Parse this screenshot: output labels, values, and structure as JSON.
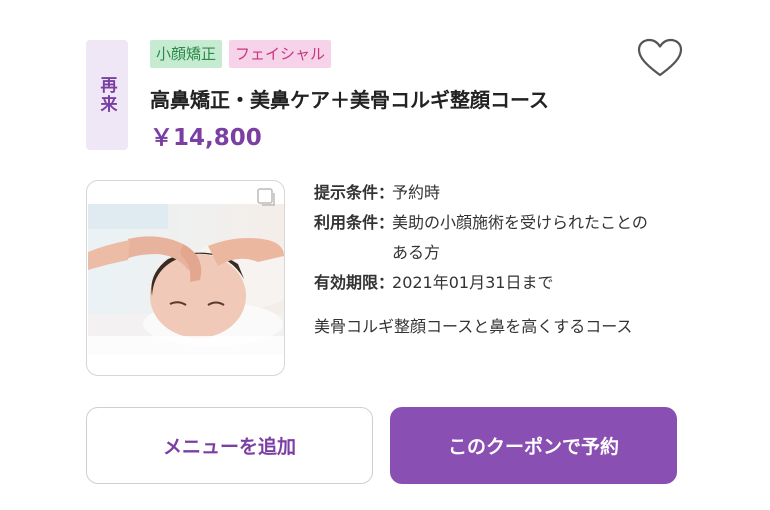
{
  "badge": {
    "label": "再来"
  },
  "tags": [
    {
      "label": "小顔矯正",
      "color": "#2a8a4a",
      "bg": "#c7ebd1"
    },
    {
      "label": "フェイシャル",
      "color": "#c4367f",
      "bg": "#f7d3ea"
    }
  ],
  "coupon": {
    "title": "高鼻矯正・美鼻ケア＋美骨コルギ整顔コース",
    "price": "￥14,800",
    "conditions": [
      {
        "label": "提示条件",
        "value": "予約時"
      },
      {
        "label": "利用条件",
        "value": "美助の小顔施術を受けられたことのある方"
      },
      {
        "label": "有効期限",
        "value": "2021年01月31日まで"
      }
    ],
    "description": "美骨コルギ整顔コースと鼻を高くするコース"
  },
  "favorite": {
    "icon": "heart-icon"
  },
  "buttons": {
    "add_menu": "メニューを追加",
    "book": "このクーポンで予約"
  },
  "colors": {
    "accent": "#8a4fb3",
    "price": "#7b3fa3"
  }
}
